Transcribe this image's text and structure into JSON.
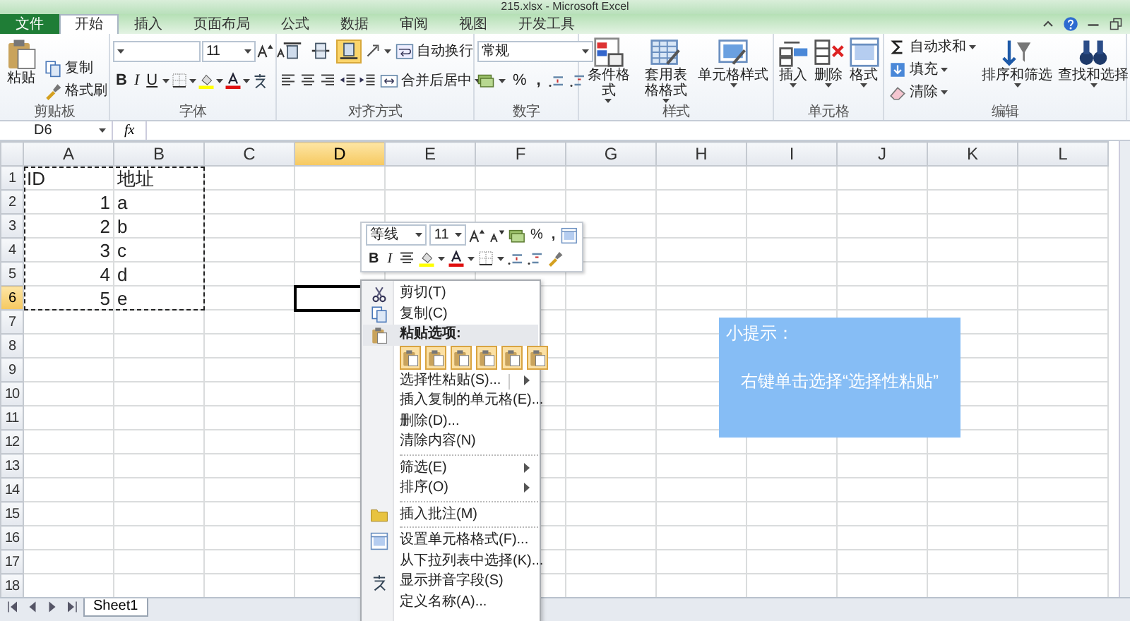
{
  "window": {
    "title": "215.xlsx - Microsoft Excel"
  },
  "tabs": [
    {
      "label": "文件",
      "kind": "file",
      "selected": false
    },
    {
      "label": "开始",
      "kind": "tab",
      "selected": true
    },
    {
      "label": "插入",
      "kind": "tab",
      "selected": false
    },
    {
      "label": "页面布局",
      "kind": "tab",
      "selected": false
    },
    {
      "label": "公式",
      "kind": "tab",
      "selected": false
    },
    {
      "label": "数据",
      "kind": "tab",
      "selected": false
    },
    {
      "label": "审阅",
      "kind": "tab",
      "selected": false
    },
    {
      "label": "视图",
      "kind": "tab",
      "selected": false
    },
    {
      "label": "开发工具",
      "kind": "tab",
      "selected": false
    }
  ],
  "ribbon": {
    "clipboard": {
      "label": "剪贴板",
      "paste": "粘贴",
      "copy": "复制",
      "format_painter": "格式刷"
    },
    "font": {
      "label": "字体",
      "size": "11",
      "bold": "B",
      "italic": "I",
      "underline": "U"
    },
    "alignment": {
      "label": "对齐方式",
      "wrap_text": "自动换行",
      "merge_center": "合并后居中",
      "vertical_align": [
        {
          "selected": false
        },
        {
          "selected": false
        },
        {
          "selected": true
        }
      ]
    },
    "number": {
      "label": "数字",
      "format": "常规",
      "percent": "%",
      "comma": ","
    },
    "styles": {
      "label": "样式",
      "conditional": "条件格式",
      "table": "套用表格格式",
      "cell_styles": "单元格样式"
    },
    "cells": {
      "label": "单元格",
      "insert": "插入",
      "delete": "删除",
      "format": "格式"
    },
    "editing": {
      "label": "编辑",
      "autosum": "自动求和",
      "fill": "填充",
      "clear": "清除",
      "sort": "排序和筛选",
      "find": "查找和选择"
    }
  },
  "formula_bar": {
    "name_box": "D6",
    "function_button": "fx"
  },
  "sheet": {
    "columns": [
      {
        "label": "A",
        "selected": false
      },
      {
        "label": "B",
        "selected": false
      },
      {
        "label": "C",
        "selected": false
      },
      {
        "label": "D",
        "selected": true
      },
      {
        "label": "E",
        "selected": false
      },
      {
        "label": "F",
        "selected": false
      },
      {
        "label": "G",
        "selected": false
      },
      {
        "label": "H",
        "selected": false
      },
      {
        "label": "I",
        "selected": false
      },
      {
        "label": "J",
        "selected": false
      },
      {
        "label": "K",
        "selected": false
      },
      {
        "label": "L",
        "selected": false
      }
    ],
    "rows": [
      {
        "label": "1",
        "selected": false,
        "cells": [
          {
            "text": "ID",
            "kind": "text",
            "copied": true
          },
          {
            "text": "地址",
            "kind": "text",
            "copied": true
          }
        ]
      },
      {
        "label": "2",
        "selected": false,
        "cells": [
          {
            "text": "1",
            "kind": "number",
            "copied": true
          },
          {
            "text": "a",
            "kind": "text",
            "copied": true
          }
        ]
      },
      {
        "label": "3",
        "selected": false,
        "cells": [
          {
            "text": "2",
            "kind": "number",
            "copied": true
          },
          {
            "text": "b",
            "kind": "text",
            "copied": true
          }
        ]
      },
      {
        "label": "4",
        "selected": false,
        "cells": [
          {
            "text": "3",
            "kind": "number",
            "copied": true
          },
          {
            "text": "c",
            "kind": "text",
            "copied": true
          }
        ]
      },
      {
        "label": "5",
        "selected": false,
        "cells": [
          {
            "text": "4",
            "kind": "number",
            "copied": true
          },
          {
            "text": "d",
            "kind": "text",
            "copied": true
          }
        ]
      },
      {
        "label": "6",
        "selected": true,
        "cells": [
          {
            "text": "5",
            "kind": "number",
            "copied": true
          },
          {
            "text": "e",
            "kind": "text",
            "copied": true
          }
        ]
      },
      {
        "label": "7",
        "selected": false,
        "cells": []
      },
      {
        "label": "8",
        "selected": false,
        "cells": []
      },
      {
        "label": "9",
        "selected": false,
        "cells": []
      },
      {
        "label": "10",
        "selected": false,
        "cells": []
      },
      {
        "label": "11",
        "selected": false,
        "cells": []
      },
      {
        "label": "12",
        "selected": false,
        "cells": []
      },
      {
        "label": "13",
        "selected": false,
        "cells": []
      },
      {
        "label": "14",
        "selected": false,
        "cells": []
      },
      {
        "label": "15",
        "selected": false,
        "cells": []
      },
      {
        "label": "16",
        "selected": false,
        "cells": []
      },
      {
        "label": "17",
        "selected": false,
        "cells": []
      },
      {
        "label": "18",
        "selected": false,
        "cells": []
      }
    ]
  },
  "sheet_tabs": [
    {
      "label": "Sheet1",
      "selected": true
    }
  ],
  "mini_toolbar": {
    "font": "等线",
    "size": "11",
    "percent": "%",
    "comma": ",",
    "bold": "B",
    "italic": "I"
  },
  "context_menu": {
    "items": [
      {
        "kind": "item",
        "label": "剪切(T)",
        "submenu": false
      },
      {
        "kind": "item",
        "label": "复制(C)",
        "submenu": false
      },
      {
        "kind": "header",
        "label": "粘贴选项:"
      },
      {
        "kind": "paste-options"
      },
      {
        "kind": "item",
        "label": "选择性粘贴(S)...",
        "submenu": true
      },
      {
        "kind": "item",
        "label": "插入复制的单元格(E)...",
        "submenu": false
      },
      {
        "kind": "item",
        "label": "删除(D)...",
        "submenu": false
      },
      {
        "kind": "item",
        "label": "清除内容(N)",
        "submenu": false
      },
      {
        "kind": "separator"
      },
      {
        "kind": "item",
        "label": "筛选(E)",
        "submenu": true
      },
      {
        "kind": "item",
        "label": "排序(O)",
        "submenu": true
      },
      {
        "kind": "separator"
      },
      {
        "kind": "item",
        "label": "插入批注(M)",
        "submenu": false
      },
      {
        "kind": "separator"
      },
      {
        "kind": "item",
        "label": "设置单元格格式(F)...",
        "submenu": false
      },
      {
        "kind": "item",
        "label": "从下拉列表中选择(K)...",
        "submenu": false
      },
      {
        "kind": "item",
        "label": "显示拼音字段(S)",
        "submenu": false
      },
      {
        "kind": "item",
        "label": "定义名称(A)...",
        "submenu": false
      }
    ]
  },
  "tip": {
    "title": "小提示：",
    "text": "右键单击选择“选择性粘贴”"
  }
}
